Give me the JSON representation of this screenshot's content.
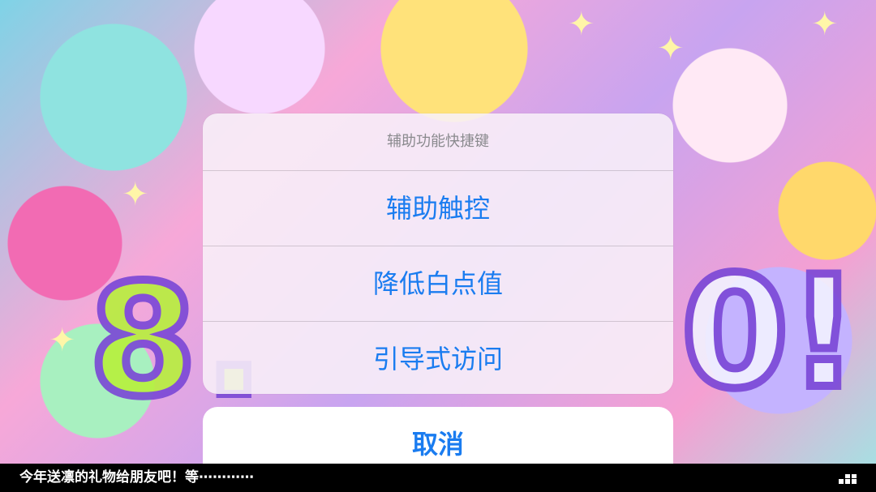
{
  "action_sheet": {
    "title": "辅助功能快捷键",
    "items": [
      {
        "label": "辅助触控"
      },
      {
        "label": "降低白点值"
      },
      {
        "label": "引导式访问"
      }
    ],
    "cancel_label": "取消"
  },
  "marquee": {
    "text": "今年送凛的礼物给朋友吧！等⋯⋯⋯⋯"
  },
  "colors": {
    "accent": "#1a7cf0",
    "title_gray": "#8a8a8e",
    "marquee_bg": "#000000"
  }
}
